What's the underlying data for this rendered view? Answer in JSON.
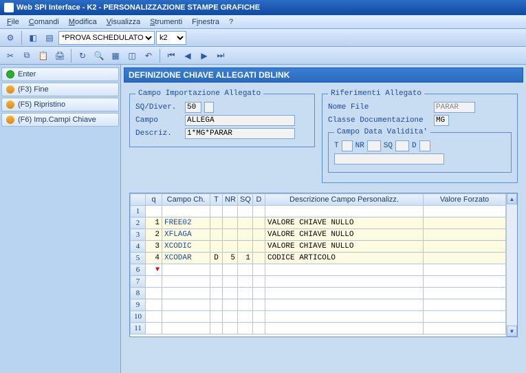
{
  "window": {
    "title": "Web SPI Interface - K2 - PERSONALIZZAZIONE STAMPE GRAFICHE"
  },
  "menu": {
    "file": "File",
    "comandi": "Comandi",
    "modifica": "Modifica",
    "visualizza": "Visualizza",
    "strumenti": "Strumenti",
    "finestra": "Finestra",
    "help": "?"
  },
  "toolbar1": {
    "combo1": "*PROVA SCHEDULATOR*",
    "combo2": "k2"
  },
  "sidebar": {
    "enter": "Enter",
    "f3": "(F3) Fine",
    "f5": "(F5) Ripristino",
    "f6": "(F6) Imp.Campi Chiave"
  },
  "panel": {
    "title": "DEFINIZIONE CHIAVE ALLEGATI DBLINK"
  },
  "import": {
    "legend": "Campo Importazione Allegato",
    "sqdiver_label": "SQ/Diver.",
    "sqdiver_value": "50",
    "campo_label": "Campo",
    "campo_value": "ALLEGA",
    "descriz_label": "Descriz.",
    "descriz_value": "1*MG*PARAR"
  },
  "rif": {
    "legend": "Riferimenti Allegato",
    "nomefile_label": "Nome File",
    "nomefile_value": "PARAR",
    "classe_label": "Classe Documentazione",
    "classe_value": "MG",
    "validita_legend": "Campo Data Validita'",
    "t_label": "T",
    "nr_label": "NR",
    "sq_label": "SQ",
    "d_label": "D"
  },
  "grid": {
    "headers": {
      "q": "q",
      "campo": "Campo Ch.",
      "t": "T",
      "nr": "NR",
      "sq": "SQ",
      "d": "D",
      "desc": "Descrizione Campo Personalizz.",
      "val": "Valore Forzato"
    },
    "rows": [
      {
        "n": "1",
        "q": "",
        "campo": "",
        "t": "",
        "nr": "",
        "sq": "",
        "d": "",
        "desc": "",
        "val": ""
      },
      {
        "n": "2",
        "q": "1",
        "campo": "FREE02",
        "t": "",
        "nr": "",
        "sq": "",
        "d": "",
        "desc": "VALORE CHIAVE NULLO",
        "val": ""
      },
      {
        "n": "3",
        "q": "2",
        "campo": "XFLAGA",
        "t": "",
        "nr": "",
        "sq": "",
        "d": "",
        "desc": "VALORE CHIAVE NULLO",
        "val": ""
      },
      {
        "n": "4",
        "q": "3",
        "campo": "XCODIC",
        "t": "",
        "nr": "",
        "sq": "",
        "d": "",
        "desc": "VALORE CHIAVE NULLO",
        "val": ""
      },
      {
        "n": "5",
        "q": "4",
        "campo": "XCODAR",
        "t": "D",
        "nr": "5",
        "sq": "1",
        "d": "",
        "desc": "CODICE ARTICOLO",
        "val": ""
      },
      {
        "n": "6",
        "q": "",
        "campo": "",
        "t": "",
        "nr": "",
        "sq": "",
        "d": "",
        "desc": "",
        "val": ""
      },
      {
        "n": "7",
        "q": "",
        "campo": "",
        "t": "",
        "nr": "",
        "sq": "",
        "d": "",
        "desc": "",
        "val": ""
      },
      {
        "n": "8",
        "q": "",
        "campo": "",
        "t": "",
        "nr": "",
        "sq": "",
        "d": "",
        "desc": "",
        "val": ""
      },
      {
        "n": "9",
        "q": "",
        "campo": "",
        "t": "",
        "nr": "",
        "sq": "",
        "d": "",
        "desc": "",
        "val": ""
      },
      {
        "n": "10",
        "q": "",
        "campo": "",
        "t": "",
        "nr": "",
        "sq": "",
        "d": "",
        "desc": "",
        "val": ""
      },
      {
        "n": "11",
        "q": "",
        "campo": "",
        "t": "",
        "nr": "",
        "sq": "",
        "d": "",
        "desc": "",
        "val": ""
      }
    ]
  }
}
